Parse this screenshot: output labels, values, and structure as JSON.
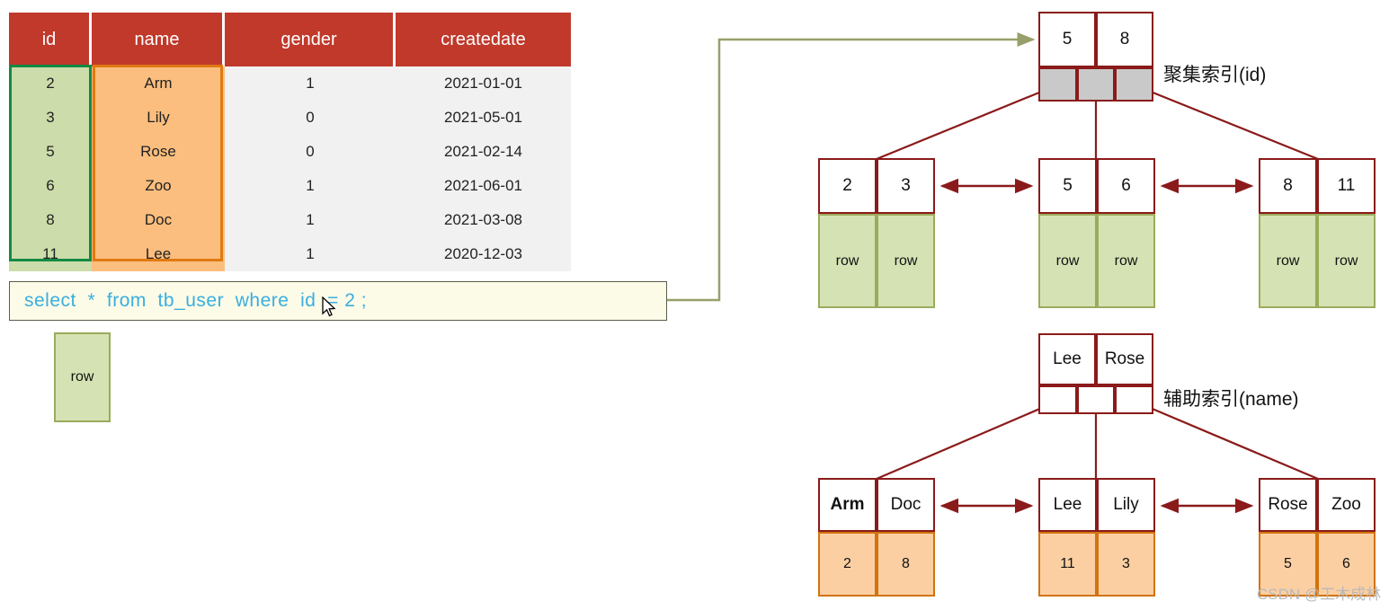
{
  "table": {
    "columns": [
      "id",
      "name",
      "gender",
      "createdate"
    ],
    "rows": [
      {
        "id": "2",
        "name": "Arm",
        "gender": "1",
        "createdate": "2021-01-01"
      },
      {
        "id": "3",
        "name": "Lily",
        "gender": "0",
        "createdate": "2021-05-01"
      },
      {
        "id": "5",
        "name": "Rose",
        "gender": "0",
        "createdate": "2021-02-14"
      },
      {
        "id": "6",
        "name": "Zoo",
        "gender": "1",
        "createdate": "2021-06-01"
      },
      {
        "id": "8",
        "name": "Doc",
        "gender": "1",
        "createdate": "2021-03-08"
      },
      {
        "id": "11",
        "name": "Lee",
        "gender": "1",
        "createdate": "2020-12-03"
      }
    ],
    "header_color": "#c0392b",
    "id_highlight_color": "#138a43",
    "name_highlight_color": "#e07a12"
  },
  "sql": {
    "query": "select  *  from  tb_user  where  id  = 2 ;",
    "text_color": "#3aaee0",
    "background": "#fbfbe8"
  },
  "result": {
    "row_label": "row"
  },
  "clustered_index": {
    "label": "聚集索引(id)",
    "root": {
      "keys": [
        "5",
        "8"
      ],
      "pointers": 3
    },
    "leaves": [
      {
        "keys": [
          "2",
          "3"
        ],
        "data": [
          "row",
          "row"
        ]
      },
      {
        "keys": [
          "5",
          "6"
        ],
        "data": [
          "row",
          "row"
        ]
      },
      {
        "keys": [
          "8",
          "11"
        ],
        "data": [
          "row",
          "row"
        ]
      }
    ]
  },
  "secondary_index": {
    "label": "辅助索引(name)",
    "root": {
      "keys": [
        "Lee",
        "Rose"
      ],
      "pointers": 3
    },
    "leaves": [
      {
        "keys": [
          "Arm",
          "Doc"
        ],
        "data": [
          "2",
          "8"
        ]
      },
      {
        "keys": [
          "Lee",
          "Lily"
        ],
        "data": [
          "11",
          "3"
        ]
      },
      {
        "keys": [
          "Rose",
          "Zoo"
        ],
        "data": [
          "5",
          "6"
        ]
      }
    ]
  },
  "watermark": {
    "text": "CSDN @工木成林"
  }
}
